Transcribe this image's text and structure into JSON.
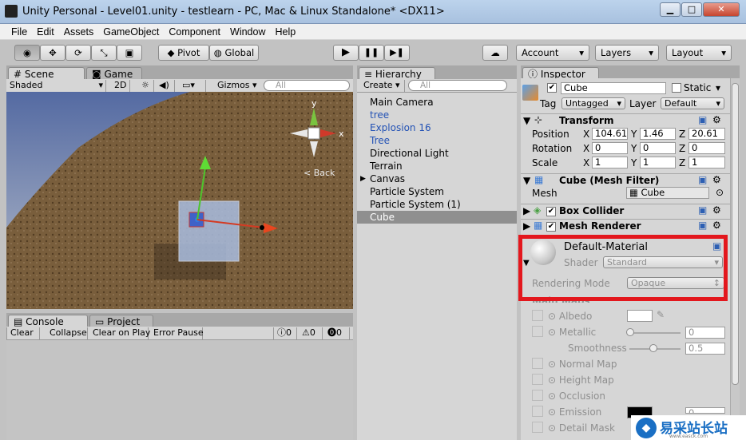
{
  "window": {
    "title": "Unity Personal - Level01.unity - testlearn - PC, Mac & Linux Standalone* <DX11>",
    "min_label": "▁",
    "max_label": "□",
    "close_label": "✕"
  },
  "menu": [
    "File",
    "Edit",
    "Assets",
    "GameObject",
    "Component",
    "Window",
    "Help"
  ],
  "toolbar": {
    "pivot": "Pivot",
    "global": "Global",
    "account": "Account",
    "layers": "Layers",
    "layout": "Layout",
    "play": "▶",
    "pause": "❚❚",
    "step": "▶❚"
  },
  "scene": {
    "tab_scene": "Scene",
    "tab_game": "Game",
    "shading": "Shaded",
    "mode_2d": "2D",
    "gizmos": "Gizmos",
    "search_placeholder": "All",
    "back_label": "Back",
    "axis_y": "y",
    "axis_x": "x"
  },
  "console": {
    "tab_console": "Console",
    "tab_project": "Project",
    "clear": "Clear",
    "collapse": "Collapse",
    "clear_on_play": "Clear on Play",
    "error_pause": "Error Pause",
    "info_count": "0",
    "warn_count": "0",
    "error_count": "0"
  },
  "hierarchy": {
    "tab": "Hierarchy",
    "create": "Create",
    "search_placeholder": "All",
    "items": [
      {
        "label": "Main Camera",
        "color": "#000000"
      },
      {
        "label": "tree",
        "color": "#2352b5"
      },
      {
        "label": "Explosion 16",
        "color": "#2352b5"
      },
      {
        "label": "Tree",
        "color": "#2352b5"
      },
      {
        "label": "Directional Light",
        "color": "#000000"
      },
      {
        "label": "Terrain",
        "color": "#000000"
      },
      {
        "label": "Canvas",
        "color": "#000000"
      },
      {
        "label": "Particle System",
        "color": "#000000"
      },
      {
        "label": "Particle System (1)",
        "color": "#000000"
      },
      {
        "label": "Cube",
        "color": "#000000"
      }
    ],
    "selected": "Cube"
  },
  "inspector": {
    "tab": "Inspector",
    "name": "Cube",
    "static_label": "Static",
    "tag_label": "Tag",
    "tag_value": "Untagged",
    "layer_label": "Layer",
    "layer_value": "Default",
    "transform": {
      "title": "Transform",
      "position_label": "Position",
      "rotation_label": "Rotation",
      "scale_label": "Scale",
      "position": {
        "x": "104.61",
        "y": "1.46",
        "z": "20.61"
      },
      "rotation": {
        "x": "0",
        "y": "0",
        "z": "0"
      },
      "scale": {
        "x": "1",
        "y": "1",
        "z": "1"
      }
    },
    "mesh_filter": {
      "title": "Cube (Mesh Filter)",
      "mesh_label": "Mesh",
      "mesh_value": "Cube"
    },
    "box_collider": {
      "title": "Box Collider"
    },
    "mesh_renderer": {
      "title": "Mesh Renderer"
    },
    "material": {
      "name": "Default-Material",
      "shader_label": "Shader",
      "shader_value": "Standard",
      "rendering_mode_label": "Rendering Mode",
      "rendering_mode_value": "Opaque",
      "main_maps_label": "Main Maps",
      "albedo": "Albedo",
      "metallic": "Metallic",
      "metallic_value": "0",
      "smoothness": "Smoothness",
      "smoothness_value": "0.5",
      "normal_map": "Normal Map",
      "height_map": "Height Map",
      "occlusion": "Occlusion",
      "emission": "Emission",
      "emission_value": "0",
      "detail_mask": "Detail Mask"
    }
  },
  "watermark": {
    "text": "易采站长站",
    "sub": "www.easck.com"
  }
}
